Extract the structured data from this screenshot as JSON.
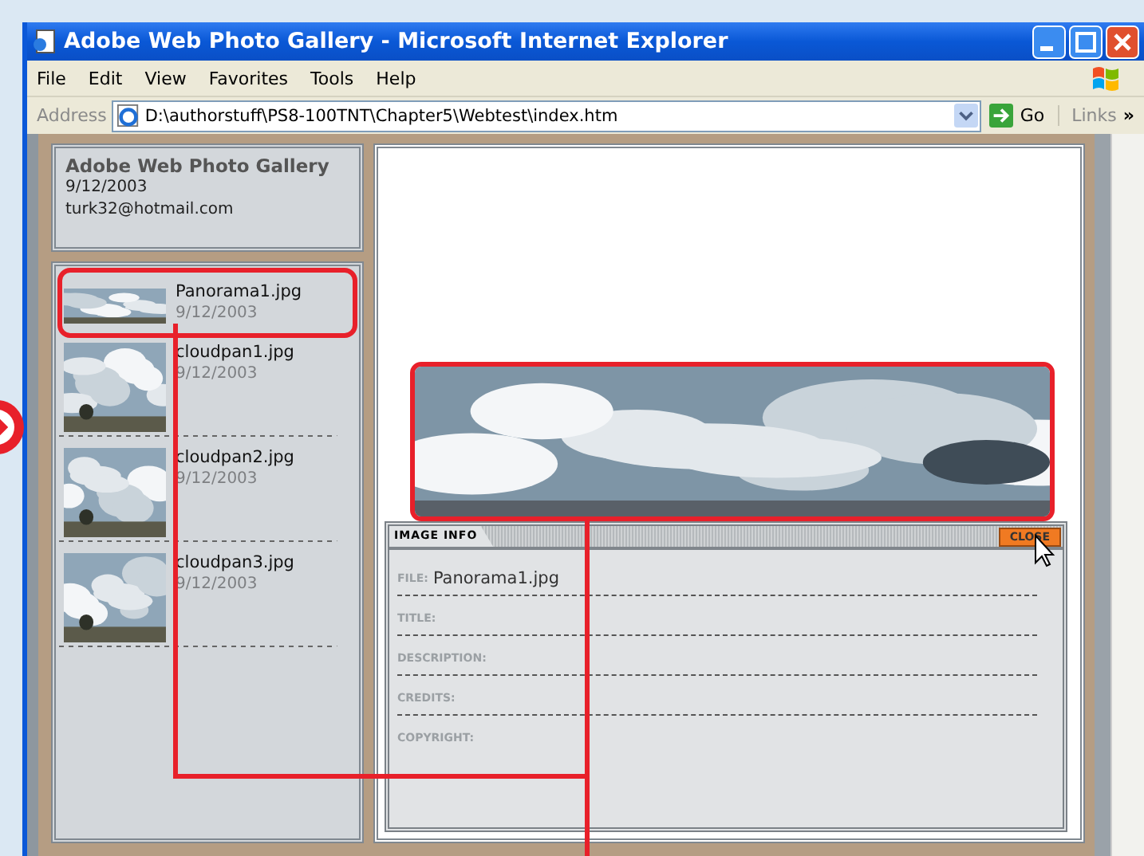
{
  "window": {
    "title": "Adobe Web Photo Gallery - Microsoft Internet Explorer"
  },
  "menu": [
    "File",
    "Edit",
    "View",
    "Favorites",
    "Tools",
    "Help"
  ],
  "address_bar": {
    "label": "Address",
    "url": "D:\\authorstuff\\PS8-100TNT\\Chapter5\\Webtest\\index.htm",
    "go": "Go",
    "links": "Links",
    "more": "»"
  },
  "gallery": {
    "title": "Adobe Web Photo Gallery",
    "date": "9/12/2003",
    "email": "turk32@hotmail.com"
  },
  "thumbnails": [
    {
      "name": "Panorama1.jpg",
      "date": "9/12/2003",
      "kind": "panorama",
      "highlighted": true
    },
    {
      "name": "cloudpan1.jpg",
      "date": "9/12/2003",
      "kind": "tall",
      "highlighted": false
    },
    {
      "name": "cloudpan2.jpg",
      "date": "9/12/2003",
      "kind": "tall",
      "highlighted": false
    },
    {
      "name": "cloudpan3.jpg",
      "date": "9/12/2003",
      "kind": "tall",
      "highlighted": false
    }
  ],
  "viewer": {
    "highlighted": true,
    "tab": "IMAGE INFO",
    "close": "CLOSE",
    "fields": [
      {
        "label": "FILE:",
        "value": "Panorama1.jpg"
      },
      {
        "label": "TITLE:"
      },
      {
        "label": "DESCRIPTION:"
      },
      {
        "label": "CREDITS:"
      },
      {
        "label": "COPYRIGHT:"
      }
    ]
  }
}
